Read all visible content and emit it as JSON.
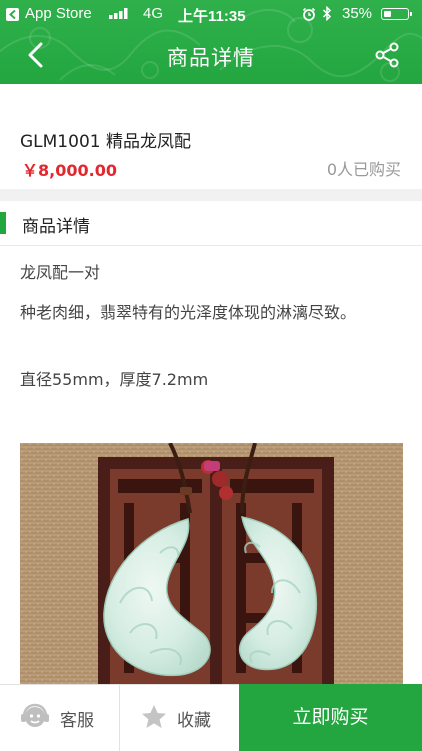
{
  "status_bar": {
    "back_app": "App Store",
    "network": "4G",
    "time": "上午11:35",
    "battery_percent": "35%",
    "battery_level": 0.35,
    "icons": [
      "back-arrow-icon",
      "signal-bars-icon",
      "alarm-icon",
      "bluetooth-icon",
      "battery-icon"
    ]
  },
  "nav": {
    "title": "商品详情",
    "back_icon": "chevron-left-icon",
    "share_icon": "share-icon"
  },
  "product": {
    "name": "GLM1001 精品龙凤配",
    "price": "￥8,000.00",
    "sold": "0人已购买"
  },
  "detail": {
    "section_title": "商品详情",
    "lines": [
      "龙凤配一对",
      "种老肉细，翡翠特有的光泽度体现的淋漓尽致。",
      "直径55mm，厚度7.2mm"
    ]
  },
  "bottom_bar": {
    "service_label": "客服",
    "service_icon": "customer-service-icon",
    "favorite_label": "收藏",
    "favorite_icon": "star-icon",
    "buy_label": "立即购买"
  },
  "colors": {
    "brand_green": "#23a63f",
    "price_red": "#e0282e"
  }
}
